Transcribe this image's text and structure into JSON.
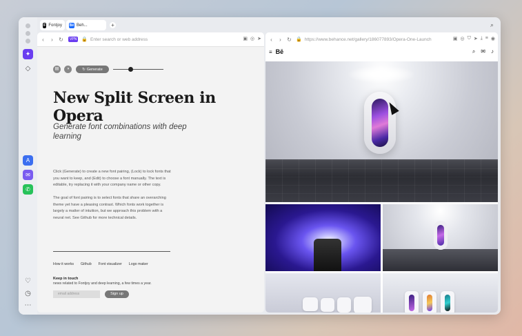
{
  "tabs": [
    {
      "label": "Fontjoy",
      "favicon": "F",
      "color": "#111111"
    },
    {
      "label": "Beh...",
      "favicon": "Bē",
      "color": "#1769ff"
    }
  ],
  "sidebar": {
    "apps": [
      "aria-icon",
      "pin-icon",
      "arc-icon",
      "messenger-icon",
      "whatsapp-icon",
      "heart-icon",
      "history-icon",
      "more-icon"
    ]
  },
  "left_pane": {
    "address_placeholder": "Enter search or web address",
    "vpn_label": "VPN",
    "generate_label": "Generate",
    "headline": "New Split Screen in Opera",
    "subhead": "Generate font combinations with deep learning",
    "para1": "Click (Generate) to create a new font pairing, (Lock) to lock fonts that you want to keep, and (Edit) to choose a font manually. The text is editable, try replacing it with your company name or other copy.",
    "para2": "The goal of font pairing is to select fonts that share an overarching theme yet have a pleasing contrast. Which fonts work together is largely a matter of intuition, but we approach this problem with a neural net. See Github for more technical details.",
    "links": [
      "How it works",
      "Github",
      "Font visualizer",
      "Logo maker"
    ],
    "keep_title": "Keep in touch",
    "keep_sub": "news related to Fontjoy and deep learning, a few times a year.",
    "email_placeholder": "email address",
    "signup_label": "Sign up"
  },
  "right_pane": {
    "url": "https://www.behance.net/gallery/186077893/Opera-One-Launch",
    "logo": "Bē"
  }
}
